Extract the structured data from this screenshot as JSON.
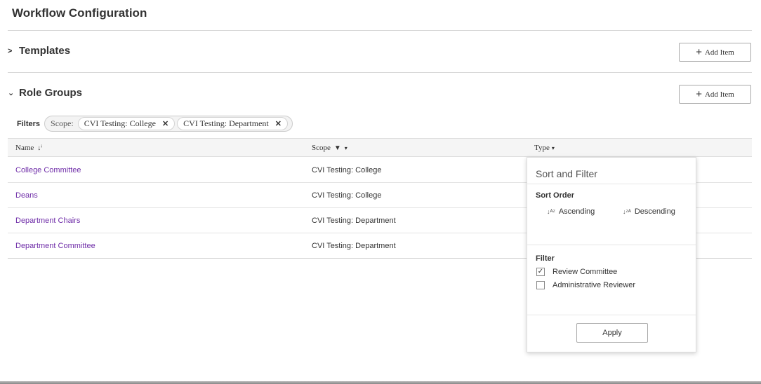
{
  "page_title": "Workflow Configuration",
  "templates": {
    "label": "Templates",
    "chevron": ">",
    "add_label": "Add Item"
  },
  "role_groups": {
    "label": "Role Groups",
    "chevron": "⌄",
    "add_label": "Add Item"
  },
  "filters": {
    "label": "Filters",
    "scope_label": "Scope:",
    "chips": [
      "CVI Testing: College",
      "CVI Testing: Department"
    ]
  },
  "table": {
    "columns": [
      "Name",
      "Scope",
      "Type"
    ],
    "rows": [
      {
        "name": "College Committee",
        "scope": "CVI Testing: College"
      },
      {
        "name": "Deans",
        "scope": "CVI Testing: College"
      },
      {
        "name": "Department Chairs",
        "scope": "CVI Testing: Department"
      },
      {
        "name": "Department Committee",
        "scope": "CVI Testing: Department"
      }
    ]
  },
  "popup": {
    "title": "Sort and Filter",
    "sort_heading": "Sort Order",
    "ascending": "Ascending",
    "descending": "Descending",
    "filter_heading": "Filter",
    "options": [
      {
        "label": "Review Committee",
        "checked": true
      },
      {
        "label": "Administrative Reviewer",
        "checked": false
      }
    ],
    "apply_label": "Apply"
  },
  "colors": {
    "link": "#6f2da8",
    "header_bg": "#f5f5f5"
  }
}
